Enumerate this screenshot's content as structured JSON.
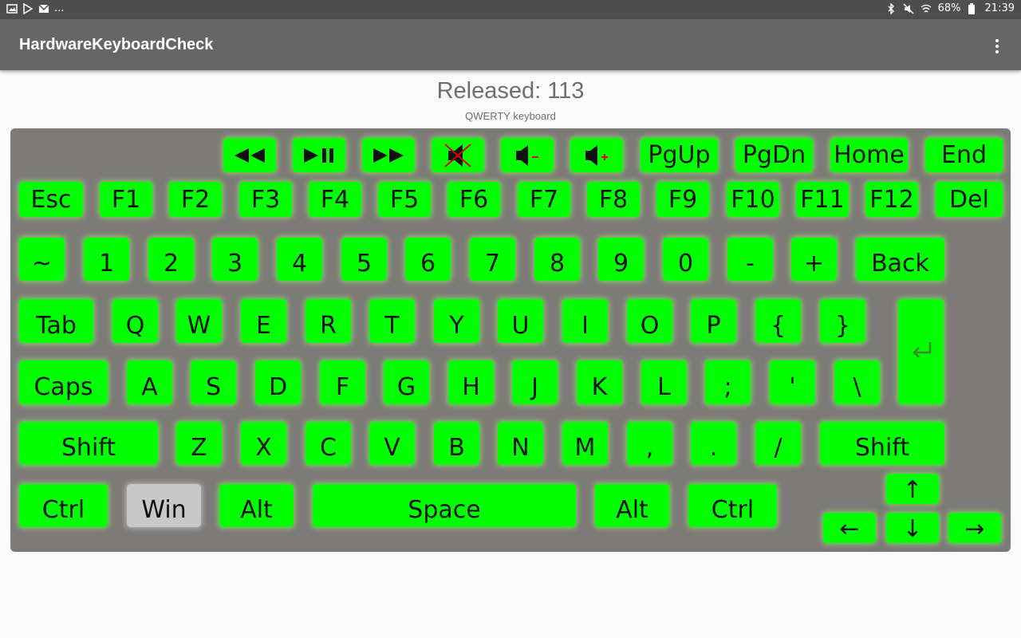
{
  "status_bar": {
    "left_icons": [
      "image-icon",
      "play-store-icon",
      "mail-icon"
    ],
    "more": "...",
    "battery": "68%",
    "time": "21:39"
  },
  "app_bar": {
    "title": "HardwareKeyboardCheck"
  },
  "event": {
    "text": "Released: 113",
    "layout": "QWERTY keyboard"
  },
  "colors": {
    "key_active": "#00ff00",
    "key_pressed": "#c8c8c8",
    "keyboard_bg": "#7d7a77",
    "appbar": "#666666"
  },
  "keys": {
    "media_row": {
      "rewind": "rewind-icon",
      "play_pause": "play-pause-icon",
      "fast_forward": "fast-forward-icon",
      "mute": "mute-icon",
      "vol_down": "volume-down-icon",
      "vol_up": "volume-up-icon",
      "pgup": "PgUp",
      "pgdn": "PgDn",
      "home": "Home",
      "end": "End"
    },
    "function_row": [
      "Esc",
      "F1",
      "F2",
      "F3",
      "F4",
      "F5",
      "F6",
      "F7",
      "F8",
      "F9",
      "F10",
      "F11",
      "F12",
      "Del"
    ],
    "number_row": [
      "~",
      "1",
      "2",
      "3",
      "4",
      "5",
      "6",
      "7",
      "8",
      "9",
      "0",
      "-",
      "+",
      "Back"
    ],
    "top_row": [
      "Tab",
      "Q",
      "W",
      "E",
      "R",
      "T",
      "Y",
      "U",
      "I",
      "O",
      "P",
      "{",
      "}"
    ],
    "home_row": [
      "Caps",
      "A",
      "S",
      "D",
      "F",
      "G",
      "H",
      "J",
      "K",
      "L",
      ";",
      "'",
      "\\"
    ],
    "enter": "enter-icon",
    "bottom_row": [
      "Shift",
      "Z",
      "X",
      "C",
      "V",
      "B",
      "N",
      "M",
      ",",
      ".",
      "/",
      "Shift"
    ],
    "space_row": [
      "Ctrl",
      "Win",
      "Alt",
      "Space",
      "Alt",
      "Ctrl"
    ],
    "arrows": {
      "up": "↑",
      "left": "←",
      "down": "↓",
      "right": "→"
    }
  }
}
